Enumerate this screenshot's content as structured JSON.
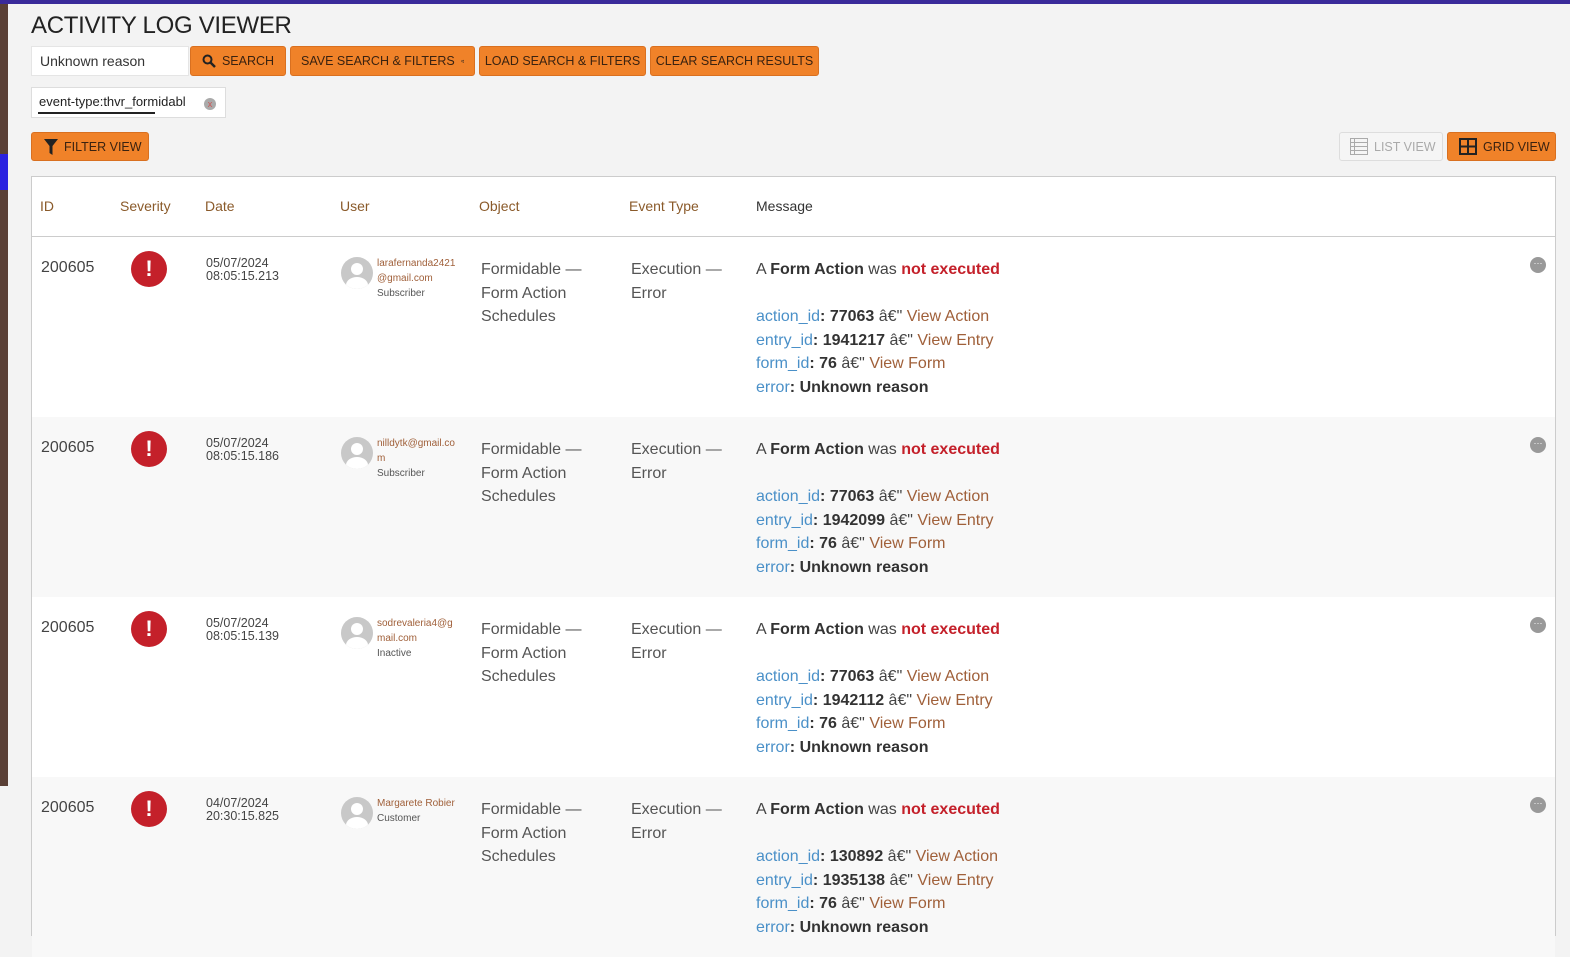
{
  "title": "ACTIVITY LOG VIEWER",
  "search": {
    "value": "Unknown reason"
  },
  "buttons": {
    "search": "SEARCH",
    "save": "SAVE SEARCH & FILTERS",
    "load": "LOAD SEARCH & FILTERS",
    "clear": "CLEAR SEARCH RESULTS",
    "filter_view": "FILTER VIEW",
    "list_view": "LIST VIEW",
    "grid_view": "GRID VIEW"
  },
  "filter_chip": {
    "label": "event-type:thvr_formidabl",
    "remove": "x"
  },
  "columns": [
    "ID",
    "Severity",
    "Date",
    "User",
    "Object",
    "Event Type",
    "Message"
  ],
  "rows": [
    {
      "id": "200605",
      "severity": "!",
      "date": "05/07/2024",
      "time": "08:05:15.213",
      "user": "larafernanda2421@gmail.com",
      "role": "Subscriber",
      "object": "Formidable — Form Action Schedules",
      "event": "Execution — Error",
      "msg_a": "A ",
      "msg_b": "Form Action",
      "msg_c": " was ",
      "msg_d": "not executed",
      "action_id": "77063",
      "entry_id": "1941217",
      "form_id": "76",
      "error": "Unknown reason"
    },
    {
      "id": "200605",
      "severity": "!",
      "date": "05/07/2024",
      "time": "08:05:15.186",
      "user": "nilldytk@gmail.com",
      "role": "Subscriber",
      "object": "Formidable — Form Action Schedules",
      "event": "Execution — Error",
      "msg_a": "A ",
      "msg_b": "Form Action",
      "msg_c": " was ",
      "msg_d": "not executed",
      "action_id": "77063",
      "entry_id": "1942099",
      "form_id": "76",
      "error": "Unknown reason"
    },
    {
      "id": "200605",
      "severity": "!",
      "date": "05/07/2024",
      "time": "08:05:15.139",
      "user": "sodrevaleria4@gmail.com",
      "role": "Inactive",
      "object": "Formidable — Form Action Schedules",
      "event": "Execution — Error",
      "msg_a": "A ",
      "msg_b": "Form Action",
      "msg_c": " was ",
      "msg_d": "not executed",
      "action_id": "77063",
      "entry_id": "1942112",
      "form_id": "76",
      "error": "Unknown reason"
    },
    {
      "id": "200605",
      "severity": "!",
      "date": "04/07/2024",
      "time": "20:30:15.825",
      "user": "Margarete Robier",
      "role": "Customer",
      "object": "Formidable — Form Action Schedules",
      "event": "Execution — Error",
      "msg_a": "A ",
      "msg_b": "Form Action",
      "msg_c": " was ",
      "msg_d": "not executed",
      "action_id": "130892",
      "entry_id": "1935138",
      "form_id": "76",
      "error": "Unknown reason"
    }
  ],
  "labels": {
    "action_id": "action_id",
    "entry_id": "entry_id",
    "form_id": "form_id",
    "error": "error",
    "sep": " â€\" ",
    "view_action": "View Action",
    "view_entry": "View Entry",
    "view_form": "View Form",
    "colon": ": ",
    "more": "···"
  }
}
